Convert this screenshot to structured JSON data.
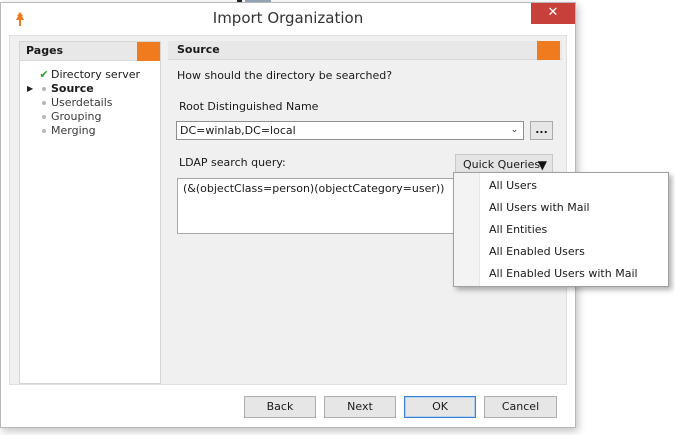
{
  "window": {
    "title": "Import Organization",
    "close_glyph": "✕",
    "icon": "app-logo-icon"
  },
  "pages": {
    "header": "Pages",
    "items": [
      {
        "label": "Directory server",
        "state": "done"
      },
      {
        "label": "Source",
        "state": "active"
      },
      {
        "label": "Userdetails",
        "state": "pending"
      },
      {
        "label": "Grouping",
        "state": "pending"
      },
      {
        "label": "Merging",
        "state": "pending"
      }
    ]
  },
  "source": {
    "header": "Source",
    "prompt": "How should the directory be searched?",
    "root_label": "Root Distinguished Name",
    "root_value": "DC=winlab,DC=local",
    "browse_label": "...",
    "ldap_label": "LDAP search query:",
    "quick_queries_label": "Quick Queries",
    "query_value": "(&(objectClass=person)(objectCategory=user))"
  },
  "quick_queries_menu": [
    "All Users",
    "All Users with Mail",
    "All Entities",
    "All Enabled Users",
    "All Enabled Users with Mail"
  ],
  "footer": {
    "back": "Back",
    "next": "Next",
    "ok": "OK",
    "cancel": "Cancel"
  },
  "colors": {
    "accent": "#f07b1e",
    "close": "#c7403a",
    "check": "#2aa02a",
    "default_button_border": "#3c7fd1"
  }
}
